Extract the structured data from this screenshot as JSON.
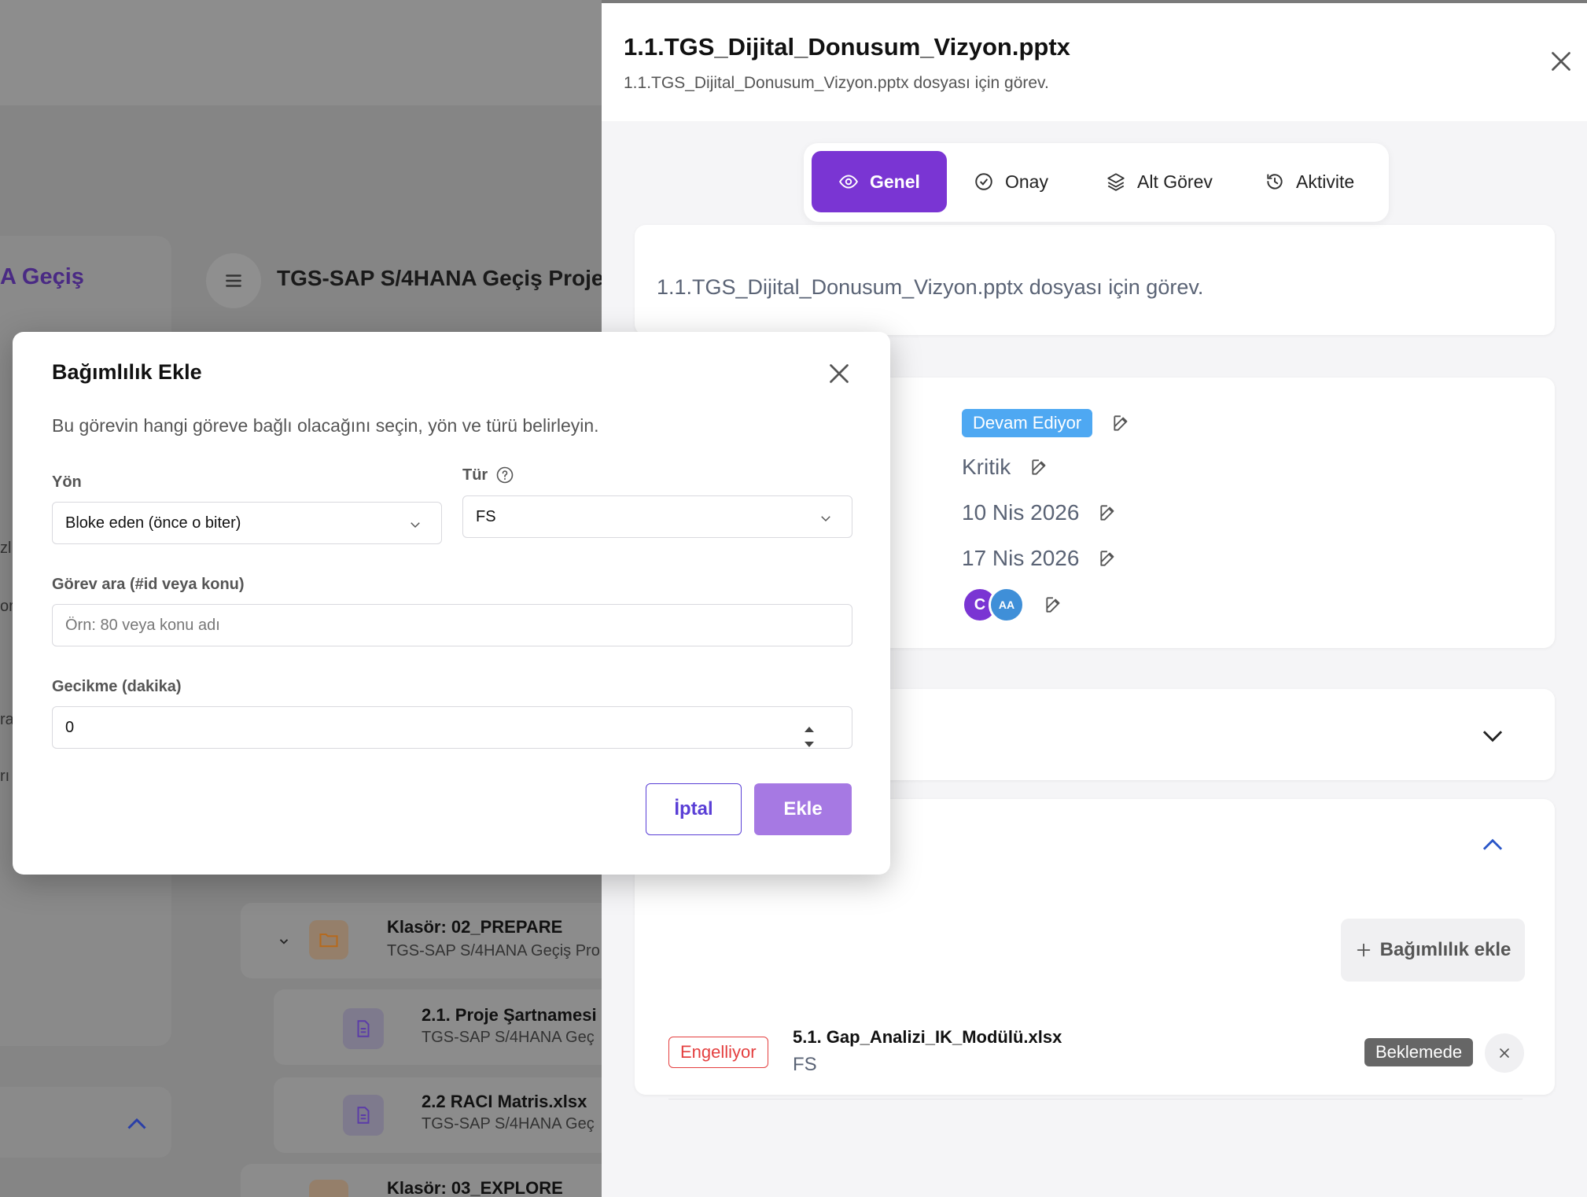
{
  "background": {
    "sidebar_title_fragment": "A Geçiş",
    "project_title": "TGS-SAP S/4HANA Geçiş Proje",
    "side_fragments": [
      "zl",
      "or",
      "ra",
      "rı"
    ],
    "folder_02": {
      "title": "Klasör: 02_PREPARE",
      "subtitle": "TGS-SAP S/4HANA Geçiş Pro"
    },
    "file_21": {
      "title": "2.1. Proje Şartnamesi",
      "subtitle": "TGS-SAP S/4HANA Geç"
    },
    "file_22": {
      "title": "2.2 RACI Matris.xlsx",
      "subtitle": "TGS-SAP S/4HANA Geç"
    },
    "folder_03": {
      "title": "Klasör: 03_EXPLORE"
    }
  },
  "drawer": {
    "title": "1.1.TGS_Dijital_Donusum_Vizyon.pptx",
    "subtitle": "1.1.TGS_Dijital_Donusum_Vizyon.pptx dosyası için görev.",
    "tabs": [
      {
        "label": "Genel",
        "icon": "eye-icon"
      },
      {
        "label": "Onay",
        "icon": "check-circle-icon"
      },
      {
        "label": "Alt Görev",
        "icon": "layers-icon"
      },
      {
        "label": "Aktivite",
        "icon": "history-icon"
      }
    ],
    "description_text": "1.1.TGS_Dijital_Donusum_Vizyon.pptx dosyası için görev.",
    "meta": {
      "status": "Devam Ediyor",
      "priority": "Kritik",
      "start_date": "10 Nis 2026",
      "end_date": "17 Nis 2026",
      "assignees": [
        "C",
        "AA"
      ]
    },
    "dependencies": {
      "add_label": "Bağımlılık ekle",
      "items": [
        {
          "relation": "Engelliyor",
          "title": "5.1. Gap_Analizi_IK_Modülü.xlsx",
          "type": "FS",
          "status": "Beklemede"
        }
      ]
    }
  },
  "modal": {
    "title": "Bağımlılık Ekle",
    "description": "Bu görevin hangi göreve bağlı olacağını seçin, yön ve türü belirleyin.",
    "direction_label": "Yön",
    "direction_value": "Bloke eden (önce o biter)",
    "type_label": "Tür",
    "type_value": "FS",
    "search_label": "Görev ara (#id veya konu)",
    "search_placeholder": "Örn: 80 veya konu adı",
    "delay_label": "Gecikme (dakika)",
    "delay_value": "0",
    "cancel_label": "İptal",
    "add_label": "Ekle"
  },
  "colors": {
    "accent": "#7a35d3",
    "status_blue": "#4ea8f2",
    "danger": "#e43f3f",
    "add_button": "#a679e3"
  }
}
